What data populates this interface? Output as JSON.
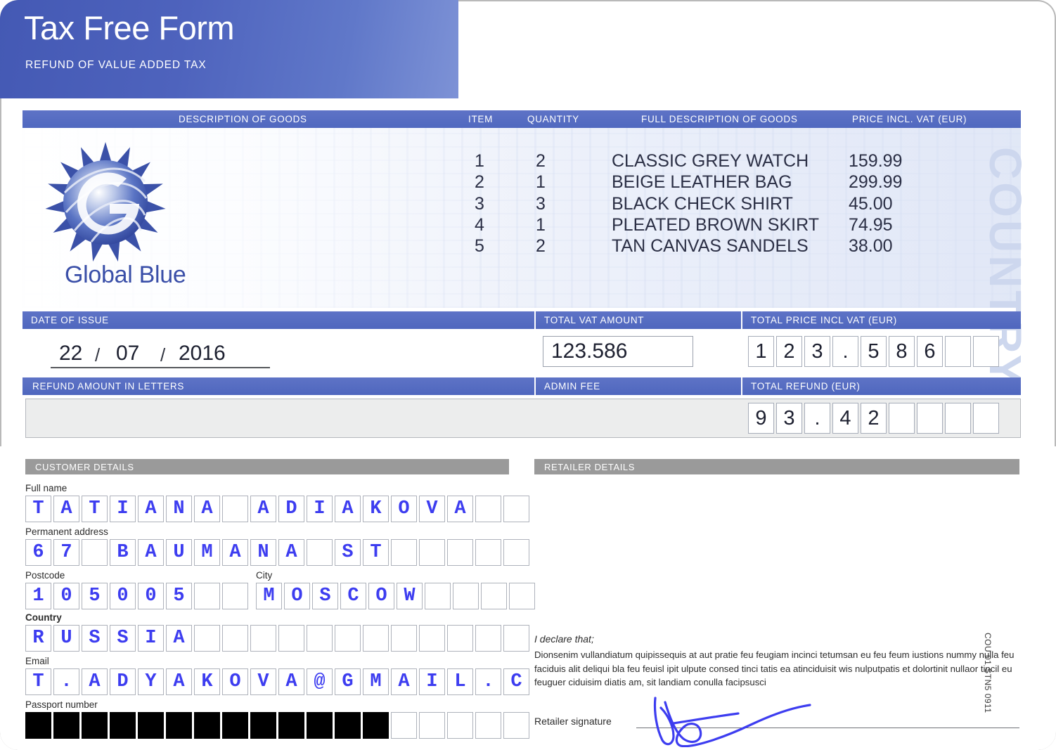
{
  "header": {
    "title": "Tax Free Form",
    "subtitle": "REFUND OF VALUE ADDED TAX"
  },
  "brand": {
    "name": "Global Blue",
    "country_watermark": "COUNTRY",
    "side_code": "COU 01 STN5 0911"
  },
  "goods": {
    "columns": {
      "description": "DESCRIPTION OF GOODS",
      "item": "ITEM",
      "quantity": "QUANTITY",
      "full_description": "FULL DESCRIPTION OF GOODS",
      "price": "PRICE INCL. VAT (EUR)"
    },
    "rows": [
      {
        "item": "1",
        "qty": "2",
        "desc": "CLASSIC GREY WATCH",
        "price": "159.99"
      },
      {
        "item": "2",
        "qty": "1",
        "desc": "BEIGE LEATHER BAG",
        "price": "299.99"
      },
      {
        "item": "3",
        "qty": "3",
        "desc": "BLACK CHECK SHIRT",
        "price": "45.00"
      },
      {
        "item": "4",
        "qty": "1",
        "desc": "PLEATED BROWN SKIRT",
        "price": "74.95"
      },
      {
        "item": "5",
        "qty": "2",
        "desc": "TAN CANVAS SANDELS",
        "price": "38.00"
      }
    ]
  },
  "totals": {
    "date_label": "DATE OF ISSUE",
    "date_day": "22",
    "date_month": "07",
    "date_year": "2016",
    "vat_label": "TOTAL VAT AMOUNT",
    "vat_value": "123.586",
    "total_label": "TOTAL PRICE INCL VAT (EUR)",
    "total_digits": [
      "1",
      "2",
      "3",
      ".",
      "5",
      "8",
      "6",
      "",
      ""
    ],
    "letters_label": "REFUND AMOUNT IN LETTERS",
    "letters_value": "",
    "admin_fee_label": "ADMIN FEE",
    "admin_fee_value": "",
    "refund_label": "TOTAL REFUND (EUR)",
    "refund_digits": [
      "9",
      "3",
      ".",
      "4",
      "2",
      "",
      "",
      "",
      ""
    ]
  },
  "customer": {
    "section_title": "CUSTOMER DETAILS",
    "full_name_label": "Full name",
    "full_name": "TATIANA ADIAKOVA",
    "full_name_cells": 18,
    "address_label": "Permanent address",
    "address": "67 BAUMANA ST",
    "address_cells": 18,
    "postcode_label": "Postcode",
    "postcode": "105005",
    "postcode_cells": 8,
    "city_label": "City",
    "city": "MOSCOW",
    "city_cells": 10,
    "country_label": "Country",
    "country": "RUSSIA",
    "country_cells": 18,
    "email_label": "Email",
    "email": "T.ADYAKOVA@GMAIL.COM",
    "email_cells": 18,
    "passport_label": "Passport number",
    "passport_cells": 18,
    "passport_redacted_cells": 13
  },
  "retailer": {
    "section_title": "RETAILER DETAILS",
    "declare_title": "I declare that;",
    "declare_body": "Dionsenim vullandiatum quipissequis at aut pratie feu feugiam incinci tetumsan eu feu feum iustions nummy nulla feu faciduis alit deliqui bla feu feuisl ipit ulpute consed tinci tatis ea atinciduisit wis nulputpatis et dolortinit nullaor tincil eu feuguer ciduisim diatis am, sit landiam conulla facipsusci",
    "signature_label": "Retailer signature"
  },
  "colors": {
    "brand_blue": "#4f67be",
    "header_gradient_start": "#4459b4",
    "handwriting": "#3d3df0",
    "grey_bar": "#9a9a9a"
  }
}
